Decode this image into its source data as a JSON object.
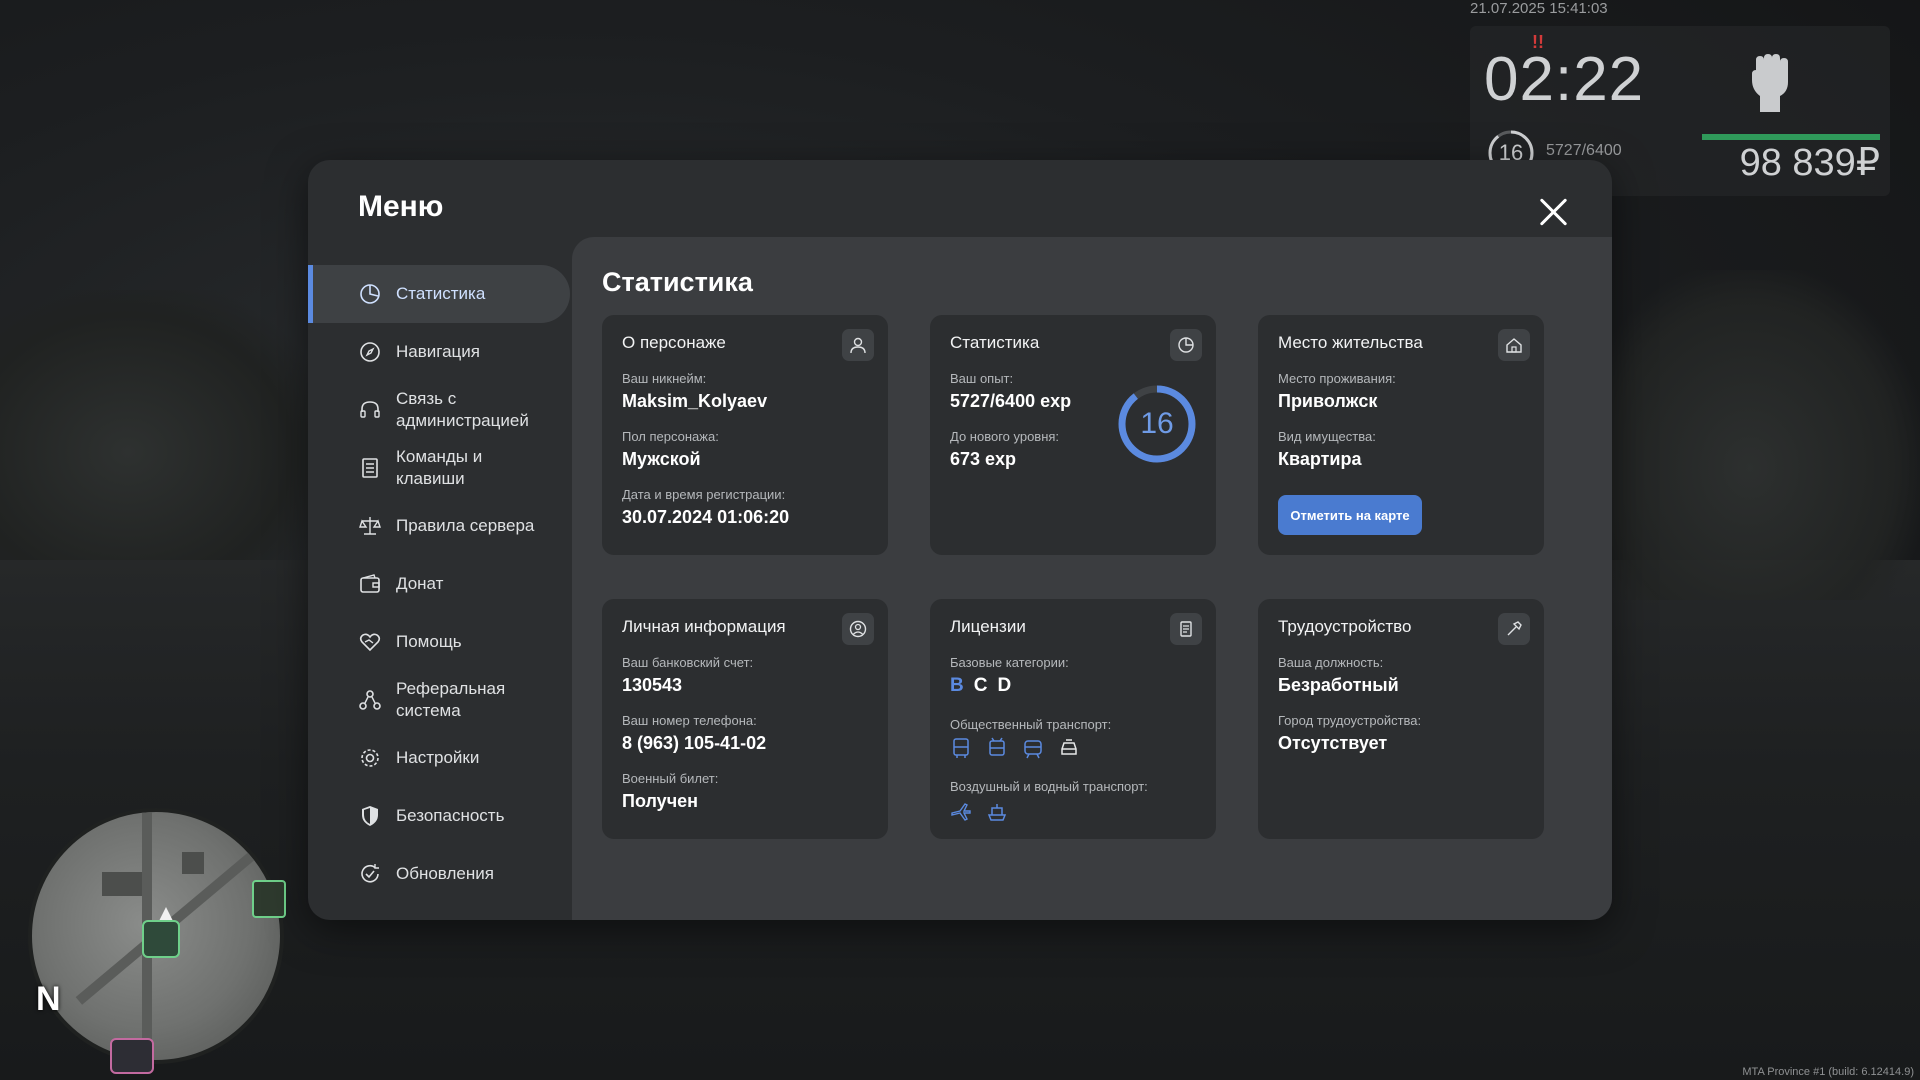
{
  "hud": {
    "datetime": "21.07.2025 15:41:03",
    "clock": "02:22",
    "alert": "!!",
    "level": "16",
    "exp": "5727/6400",
    "money": "98 839₽"
  },
  "minimap": {
    "north": "N"
  },
  "build": "MTA Province #1 (build: 6.12414.9)",
  "menu": {
    "title": "Меню",
    "sidebar": [
      {
        "label": "Статистика",
        "icon": "pie-chart-icon",
        "active": true
      },
      {
        "label": "Навигация",
        "icon": "compass-icon"
      },
      {
        "label": "Связь с\nадминистрацией",
        "icon": "headset-icon"
      },
      {
        "label": "Команды и\nклавиши",
        "icon": "list-icon"
      },
      {
        "label": "Правила сервера",
        "icon": "scales-icon"
      },
      {
        "label": "Донат",
        "icon": "wallet-icon"
      },
      {
        "label": "Помощь",
        "icon": "heart-hand-icon"
      },
      {
        "label": "Реферальная\nсистема",
        "icon": "network-icon"
      },
      {
        "label": "Настройки",
        "icon": "gear-icon"
      },
      {
        "label": "Безопасность",
        "icon": "shield-icon"
      },
      {
        "label": "Обновления",
        "icon": "refresh-check-icon"
      }
    ],
    "content_title": "Статистика",
    "cards": {
      "character": {
        "title": "О персонаже",
        "nick_label": "Ваш никнейм:",
        "nick": "Maksim_Kolyaev",
        "gender_label": "Пол персонажа:",
        "gender": "Мужской",
        "reg_label": "Дата и время регистрации:",
        "reg": "30.07.2024 01:06:20"
      },
      "stats": {
        "title": "Статистика",
        "exp_label": "Ваш опыт:",
        "exp": "5727/6400 exp",
        "next_label": "До нового уровня:",
        "next": "673 exp",
        "level": "16",
        "progress": 0.895
      },
      "residence": {
        "title": "Место жительства",
        "place_label": "Место проживания:",
        "place": "Приволжск",
        "property_label": "Вид имущества:",
        "property": "Квартира",
        "button": "Отметить на карте"
      },
      "personal": {
        "title": "Личная информация",
        "bank_label": "Ваш банковский счет:",
        "bank": "130543",
        "phone_label": "Ваш номер телефона:",
        "phone": "8 (963) 105-41-02",
        "military_label": "Военный билет:",
        "military": "Получен"
      },
      "licenses": {
        "title": "Лицензии",
        "base_label": "Базовые категории:",
        "categories": [
          "B",
          "C",
          "D"
        ],
        "public_label": "Общественный транспорт:",
        "public_icons": [
          "bus-icon",
          "trolleybus-icon",
          "tram-icon",
          "taxi-icon"
        ],
        "air_label": "Воздушный и водный транспорт:",
        "air_icons": [
          "plane-icon",
          "boat-icon"
        ]
      },
      "job": {
        "title": "Трудоустройство",
        "position_label": "Ваша должность:",
        "position": "Безработный",
        "city_label": "Город трудоустройства:",
        "city": "Отсутствует"
      }
    }
  },
  "colors": {
    "accent": "#5b8ae0",
    "button": "#4a7bd0",
    "hud_bar": "#2f9a5a"
  }
}
